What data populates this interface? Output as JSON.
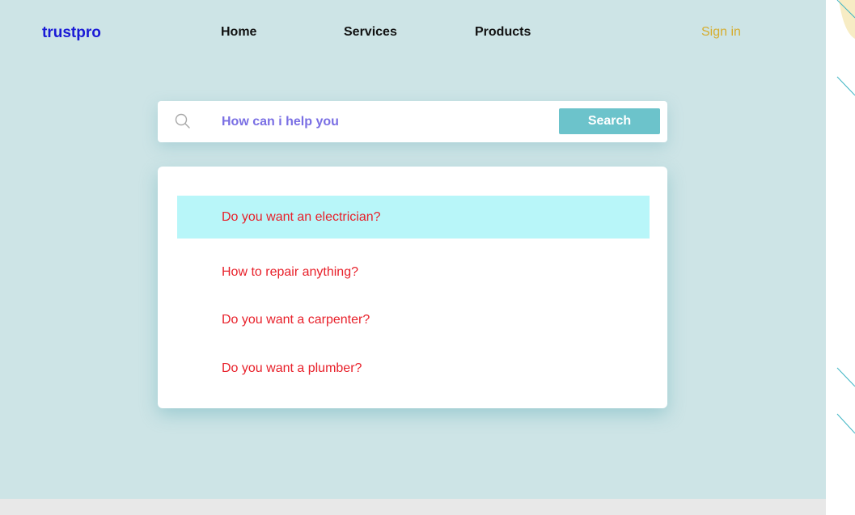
{
  "header": {
    "logo": "trustpro",
    "nav": [
      "Home",
      "Services",
      "Products"
    ],
    "sign_in": "Sign in"
  },
  "search": {
    "icon": "search-icon",
    "placeholder": "How can i help you",
    "button_label": "Search"
  },
  "suggestions": {
    "items": [
      "Do you want an electrician?",
      "How to repair anything?",
      "Do you want a carpenter?",
      "Do you want a plumber?"
    ],
    "highlighted_index": 0
  },
  "colors": {
    "background": "#cde4e6",
    "logo": "#1a1ad6",
    "sign_in": "#d6ad2e",
    "search_text": "#7a6fe4",
    "search_button": "#6cc3cb",
    "suggestion_text": "#e8202a",
    "suggestion_highlight": "#b8f6f9"
  }
}
